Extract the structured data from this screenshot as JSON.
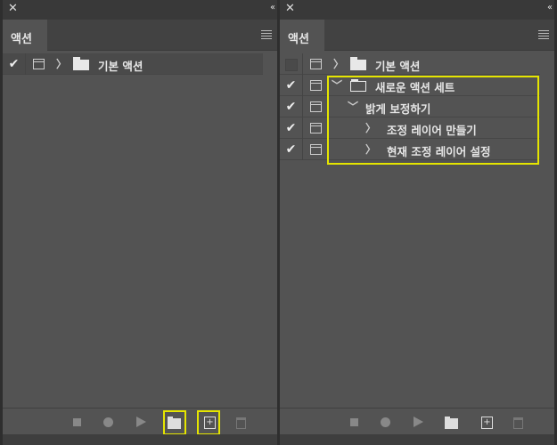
{
  "left_panel": {
    "tab": "액션",
    "rows": [
      {
        "label": "기본 액션",
        "checked": true
      }
    ]
  },
  "right_panel": {
    "tab": "액션",
    "rows": [
      {
        "label": "기본 액션",
        "checked": false
      },
      {
        "label": "새로운 액션 세트",
        "checked": true
      },
      {
        "label": "밝게 보정하기",
        "checked": true
      },
      {
        "label": "조정 레이어 만들기",
        "checked": true
      },
      {
        "label": "현재 조정 레이어 설정",
        "checked": true
      }
    ]
  },
  "icons": {
    "close": "✕",
    "collapse": "‹‹",
    "check": "✔",
    "expand": "〉",
    "collapse_tw": "﹀",
    "new_action": "+"
  },
  "highlight_color": "#e5e500"
}
